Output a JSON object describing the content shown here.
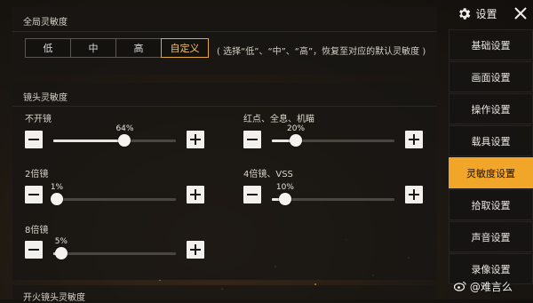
{
  "global": {
    "title": "全局灵敏度",
    "options": [
      "低",
      "中",
      "高",
      "自定义"
    ],
    "selected": "自定义",
    "note": "( 选择“低”、“中”、“高”，恢复至对应的默认灵敏度 )"
  },
  "scope": {
    "title": "镜头灵敏度",
    "sliders": [
      {
        "label": "不开镜",
        "value": 64,
        "value_text": "64%"
      },
      {
        "label": "红点、全息、机瞄",
        "value": 20,
        "value_text": "20%"
      },
      {
        "label": "2倍镜",
        "value": 1,
        "value_text": "1%"
      },
      {
        "label": "4倍镜、VSS",
        "value": 10,
        "value_text": "10%"
      },
      {
        "label": "8倍镜",
        "value": 5,
        "value_text": "5%"
      }
    ]
  },
  "fire": {
    "title": "开火镜头灵敏度"
  },
  "sidebar": {
    "header": "设置",
    "items": [
      "基础设置",
      "画面设置",
      "操作设置",
      "载具设置",
      "灵敏度设置",
      "拾取设置",
      "声音设置",
      "录像设置"
    ],
    "active": "灵敏度设置"
  },
  "watermark": "@难言么",
  "colors": {
    "accent": "#f1a629",
    "selected_border": "#e2a93a"
  },
  "icons": {
    "settings": "gear-icon",
    "close": "close-icon",
    "decrease": "minus-icon",
    "increase": "plus-icon",
    "watermark": "weibo-icon"
  }
}
